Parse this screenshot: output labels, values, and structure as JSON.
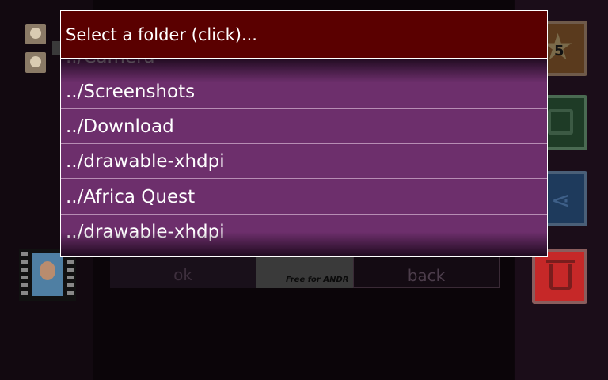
{
  "dialog": {
    "title": "Select a folder (click)...",
    "folders": [
      "../Camera",
      "../Screenshots",
      "../Download",
      "../drawable-xhdpi",
      "../Africa Quest",
      "../drawable-xhdpi"
    ]
  },
  "app": {
    "ok_label": "ok",
    "back_label": "back",
    "ad_text": "Free for ANDR",
    "badge_count": "5"
  }
}
